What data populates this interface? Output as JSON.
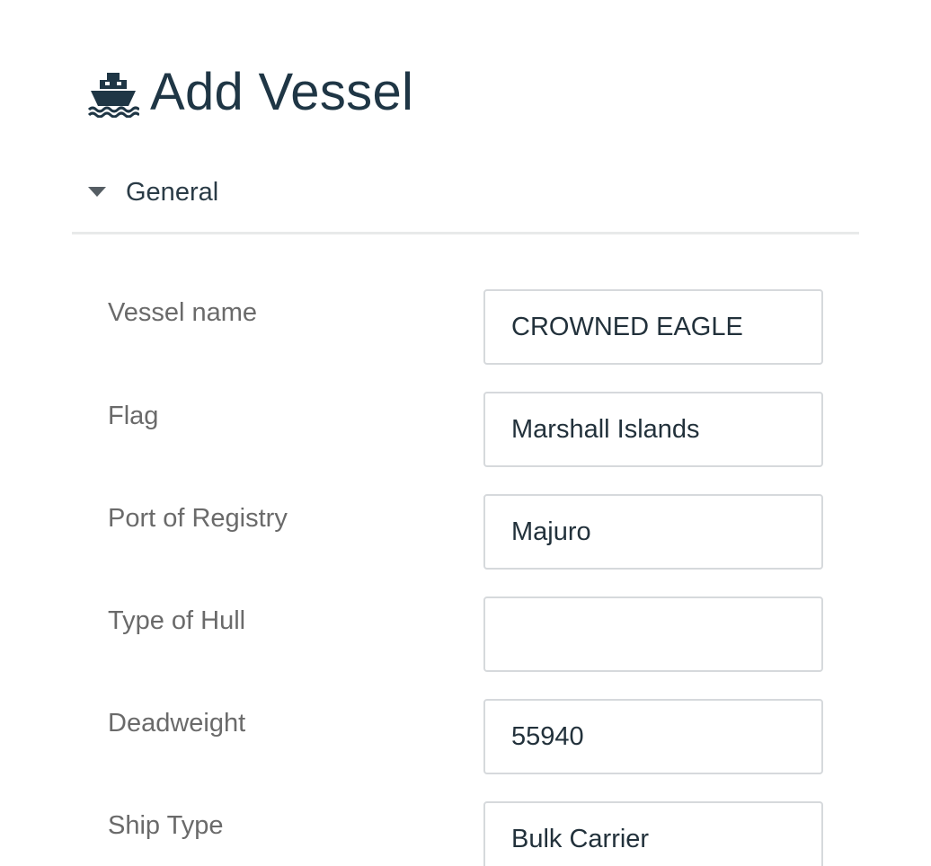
{
  "header": {
    "icon": "ship-icon",
    "title": "Add Vessel"
  },
  "section": {
    "icon": "caret-down-icon",
    "label": "General",
    "expanded": true
  },
  "fields": [
    {
      "label": "Vessel name",
      "value": "CROWNED EAGLE",
      "placeholder": ""
    },
    {
      "label": "Flag",
      "value": "Marshall Islands",
      "placeholder": ""
    },
    {
      "label": "Port of Registry",
      "value": "Majuro",
      "placeholder": ""
    },
    {
      "label": "Type of Hull",
      "value": "",
      "placeholder": ""
    },
    {
      "label": "Deadweight",
      "value": "55940",
      "placeholder": ""
    },
    {
      "label": "Ship Type",
      "value": "Bulk Carrier",
      "placeholder": ""
    }
  ],
  "colors": {
    "title": "#1f3645",
    "label": "#6a6a6a",
    "input_border": "#d6d9dc",
    "divider": "#e8eaea"
  }
}
